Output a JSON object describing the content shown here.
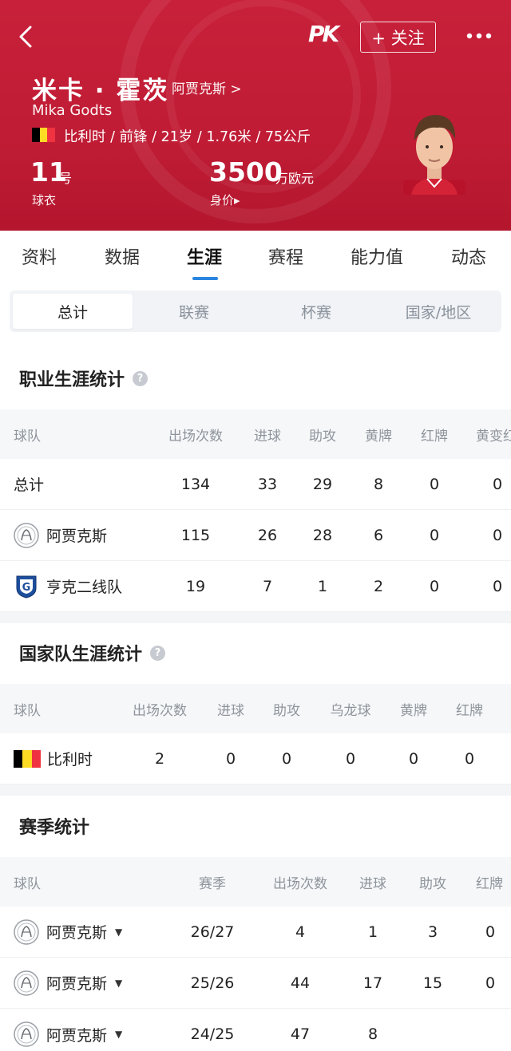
{
  "header": {
    "logo_text": "PK",
    "follow_label": "+ 关注",
    "player_name": "米卡 · 霍茨",
    "club_link": "阿贾克斯 >",
    "name_en": "Mika Godts",
    "info_line": "比利时 / 前锋 / 21岁 / 1.76米 / 75公斤",
    "shirt_number": "11",
    "shirt_unit": "号",
    "shirt_label": "球衣",
    "value_number": "3500",
    "value_unit": "万欧元",
    "value_label": "身价▸",
    "colors": {
      "header_bg": "#c01c35",
      "accent": "#2a86e0"
    },
    "flag_colors": [
      "#000000",
      "#fdda24",
      "#ef3340"
    ]
  },
  "tabs": [
    "资料",
    "数据",
    "生涯",
    "赛程",
    "能力值",
    "动态"
  ],
  "active_tab": "生涯",
  "segments": [
    "总计",
    "联赛",
    "杯赛",
    "国家/地区"
  ],
  "active_segment": "总计",
  "career": {
    "title": "职业生涯统计",
    "headers": [
      "球队",
      "出场次数",
      "进球",
      "助攻",
      "黄牌",
      "红牌",
      "黄变红"
    ],
    "rows": [
      {
        "team": "总计",
        "icon": "",
        "vals": [
          "134",
          "33",
          "29",
          "8",
          "0",
          "0"
        ]
      },
      {
        "team": "阿贾克斯",
        "icon": "ajax-crest-icon",
        "vals": [
          "115",
          "26",
          "28",
          "6",
          "0",
          "0"
        ]
      },
      {
        "team": "亨克二线队",
        "icon": "genk-crest-icon",
        "vals": [
          "19",
          "7",
          "1",
          "2",
          "0",
          "0"
        ]
      }
    ]
  },
  "national": {
    "title": "国家队生涯统计",
    "headers": [
      "球队",
      "出场次数",
      "进球",
      "助攻",
      "乌龙球",
      "黄牌",
      "红牌"
    ],
    "rows": [
      {
        "team": "比利时",
        "icon": "belgium-flag-icon",
        "vals": [
          "2",
          "0",
          "0",
          "0",
          "0",
          "0"
        ]
      }
    ]
  },
  "season": {
    "title": "赛季统计",
    "headers": [
      "球队",
      "赛季",
      "出场次数",
      "进球",
      "助攻",
      "红牌"
    ],
    "rows": [
      {
        "team": "阿贾克斯",
        "icon": "ajax-crest-icon",
        "vals": [
          "26/27",
          "4",
          "1",
          "3",
          "0"
        ]
      },
      {
        "team": "阿贾克斯",
        "icon": "ajax-crest-icon",
        "vals": [
          "25/26",
          "44",
          "17",
          "15",
          "0"
        ]
      },
      {
        "team": "阿贾克斯",
        "icon": "ajax-crest-icon",
        "vals": [
          "24/25",
          "47",
          "8",
          "",
          ""
        ]
      }
    ]
  }
}
